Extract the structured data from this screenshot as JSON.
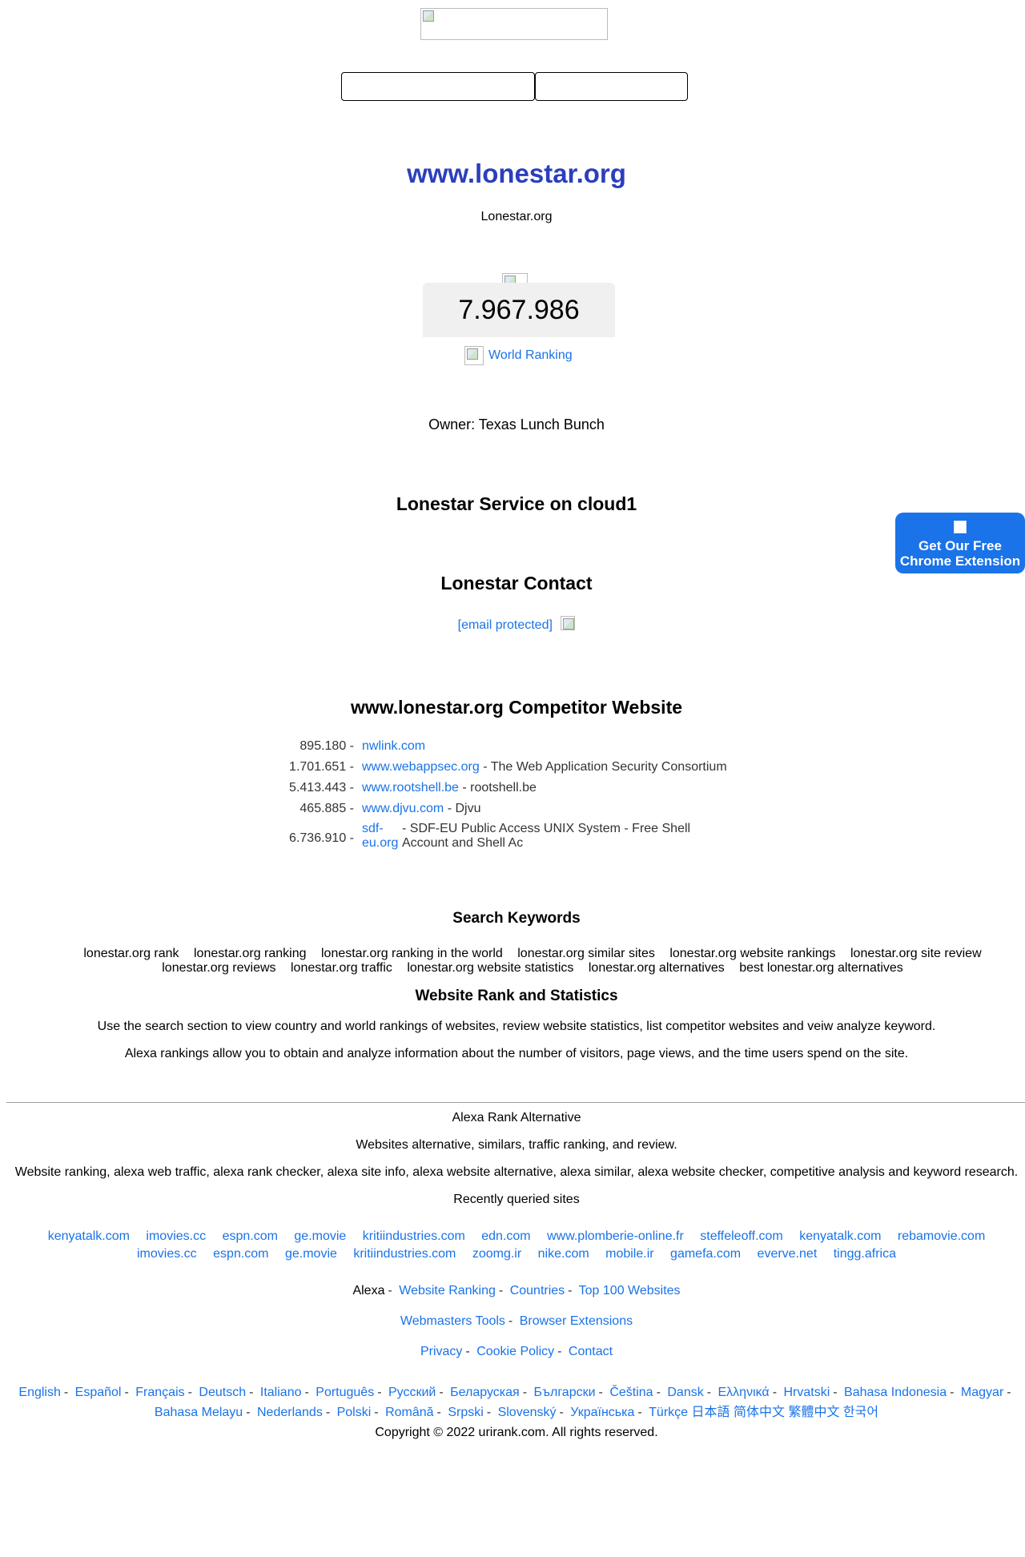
{
  "site": {
    "heading": "www.lonestar.org",
    "subtitle": "Lonestar.org",
    "rank": "7.967.986",
    "world_ranking_label": "World Ranking",
    "owner": "Owner: Texas Lunch Bunch",
    "service_heading": "Lonestar Service on cloud1",
    "contact_heading": "Lonestar Contact",
    "email_text": "[email protected]"
  },
  "chrome_extension": {
    "line1": "Get Our Free",
    "line2": "Chrome Extension"
  },
  "competitors": {
    "heading": "www.lonestar.org Competitor Website",
    "rows": [
      {
        "rank": "895.180 -",
        "link": "nwlink.com",
        "desc": ""
      },
      {
        "rank": "1.701.651 -",
        "link": "www.webappsec.org",
        "desc": "- The Web Application Security Consortium"
      },
      {
        "rank": "5.413.443 -",
        "link": "www.rootshell.be",
        "desc": "- rootshell.be"
      },
      {
        "rank": "465.885 -",
        "link": "www.djvu.com",
        "desc": "- Djvu"
      },
      {
        "rank": "6.736.910 -",
        "link": "sdf-eu.org",
        "desc": "- SDF-EU Public Access UNIX System - Free Shell Account and Shell Ac"
      }
    ]
  },
  "keywords": {
    "heading": "Search Keywords",
    "items": [
      "lonestar.org rank",
      "lonestar.org ranking",
      "lonestar.org ranking in the world",
      "lonestar.org similar sites",
      "lonestar.org website rankings",
      "lonestar.org site review",
      "lonestar.org reviews",
      "lonestar.org traffic",
      "lonestar.org website statistics",
      "lonestar.org alternatives",
      "best lonestar.org alternatives"
    ]
  },
  "stats": {
    "heading": "Website Rank and Statistics",
    "p1": "Use the search section to view country and world rankings of websites, review website statistics, list competitor websites and veiw analyze keyword.",
    "p2": "Alexa rankings allow you to obtain and analyze information about the number of visitors, page views, and the time users spend on the site."
  },
  "footer": {
    "title": "Alexa Rank Alternative",
    "line1": "Websites alternative, similars, traffic ranking, and review.",
    "line2": "Website ranking, alexa web traffic, alexa rank checker, alexa site info, alexa website alternative, alexa similar, alexa website checker, competitive analysis and keyword research.",
    "recent_label": "Recently queried sites",
    "recent_row1": [
      "kenyatalk.com",
      "imovies.cc",
      "espn.com",
      "ge.movie",
      "kritiindustries.com",
      "edn.com",
      "www.plomberie-online.fr",
      "steffeleoff.com",
      "kenyatalk.com",
      "rebamovie.com"
    ],
    "recent_row2": [
      "imovies.cc",
      "espn.com",
      "ge.movie",
      "kritiindustries.com",
      "zoomg.ir",
      "nike.com",
      "mobile.ir",
      "gamefa.com",
      "everve.net",
      "tingg.africa"
    ],
    "nav1": {
      "prefix": "Alexa",
      "links": [
        "Website Ranking",
        "Countries",
        "Top 100 Websites"
      ]
    },
    "nav2": [
      "Webmasters Tools",
      "Browser Extensions"
    ],
    "nav3": [
      "Privacy",
      "Cookie Policy",
      "Contact"
    ],
    "languages": [
      "English",
      "Español",
      "Français",
      "Deutsch",
      "Italiano",
      "Português",
      "Русский",
      "Беларуская",
      "Български",
      "Čeština",
      "Dansk",
      "Ελληνικά",
      "Hrvatski",
      "Bahasa Indonesia",
      "Magyar",
      "Bahasa Melayu",
      "Nederlands",
      "Polski",
      "Română",
      "Srpski",
      "Slovenský",
      "Українська",
      "Türkçe",
      "日本語",
      "简体中文",
      "繁體中文",
      "한국어"
    ],
    "copyright": "Copyright © 2022 urirank.com. All rights reserved."
  }
}
